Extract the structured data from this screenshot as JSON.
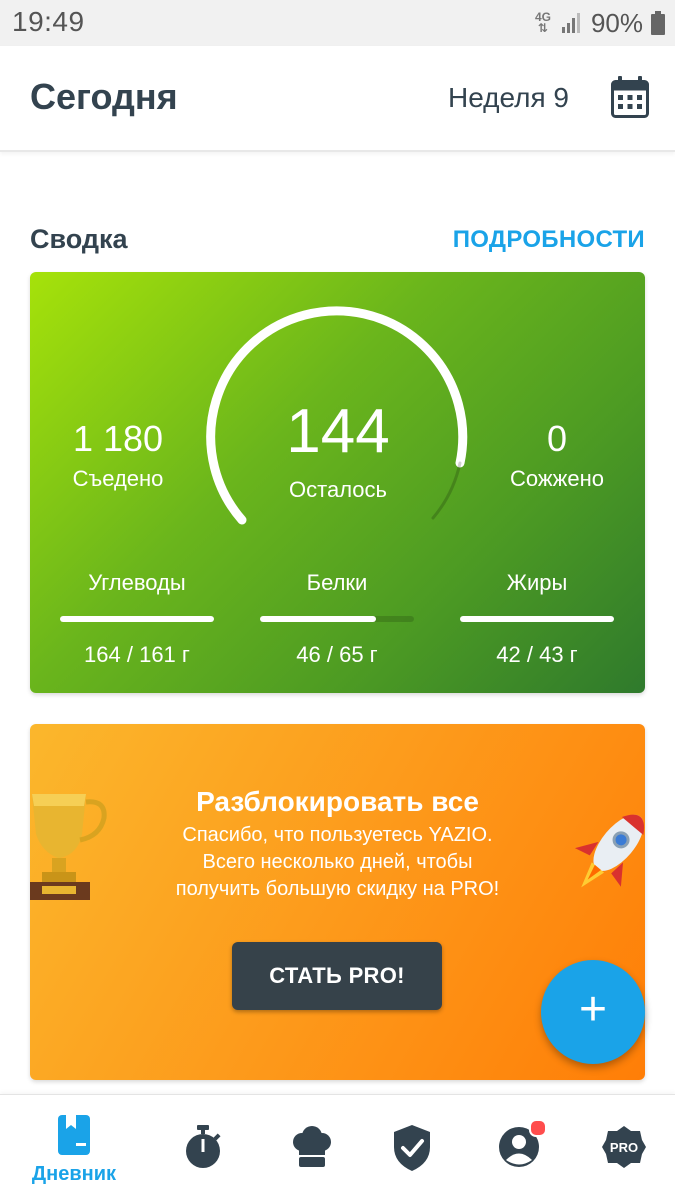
{
  "status_bar": {
    "time": "19:49",
    "network": "4G",
    "battery": "90%"
  },
  "header": {
    "title": "Сегодня",
    "week": "Неделя 9",
    "calendar_icon": "calendar-icon"
  },
  "summary": {
    "title": "Сводка",
    "details_link": "ПОДРОБНОСТИ",
    "eaten_value": "1 180",
    "eaten_label": "Съедено",
    "remaining_value": "144",
    "remaining_label": "Осталось",
    "burned_value": "0",
    "burned_label": "Сожжено",
    "macros": [
      {
        "label": "Углеводы",
        "value": "164 / 161 г",
        "progress": 1.0
      },
      {
        "label": "Белки",
        "value": "46 / 65 г",
        "progress": 0.75
      },
      {
        "label": "Жиры",
        "value": "42 / 43 г",
        "progress": 1.0
      }
    ],
    "colors": {
      "card_start": "#a6e20a",
      "card_end": "#2f7a2c"
    }
  },
  "pro_card": {
    "title": "Разблокировать все",
    "text_line1": "Спасибо, что пользуетесь YAZIO.",
    "text_line2": "Всего несколько дней, чтобы",
    "text_line3": "получить большую скидку на PRO!",
    "button": "СТАТЬ PRO!",
    "colors": {
      "card_start": "#fbb72c",
      "card_end": "#ff7e07",
      "button": "#36424a"
    }
  },
  "fab": {
    "icon": "plus-icon",
    "label": "+"
  },
  "bottom_nav": {
    "items": [
      {
        "name": "diary",
        "label": "Дневник",
        "icon": "diary-book-icon",
        "active": true
      },
      {
        "name": "fasting",
        "icon": "stopwatch-icon"
      },
      {
        "name": "recipes",
        "icon": "chef-hat-icon"
      },
      {
        "name": "analysis",
        "icon": "shield-check-icon"
      },
      {
        "name": "profile",
        "icon": "user-icon",
        "notification": true
      },
      {
        "name": "pro",
        "icon": "pro-badge-icon",
        "badge_text": "PRO"
      }
    ],
    "accent": "#1aa3e8"
  }
}
